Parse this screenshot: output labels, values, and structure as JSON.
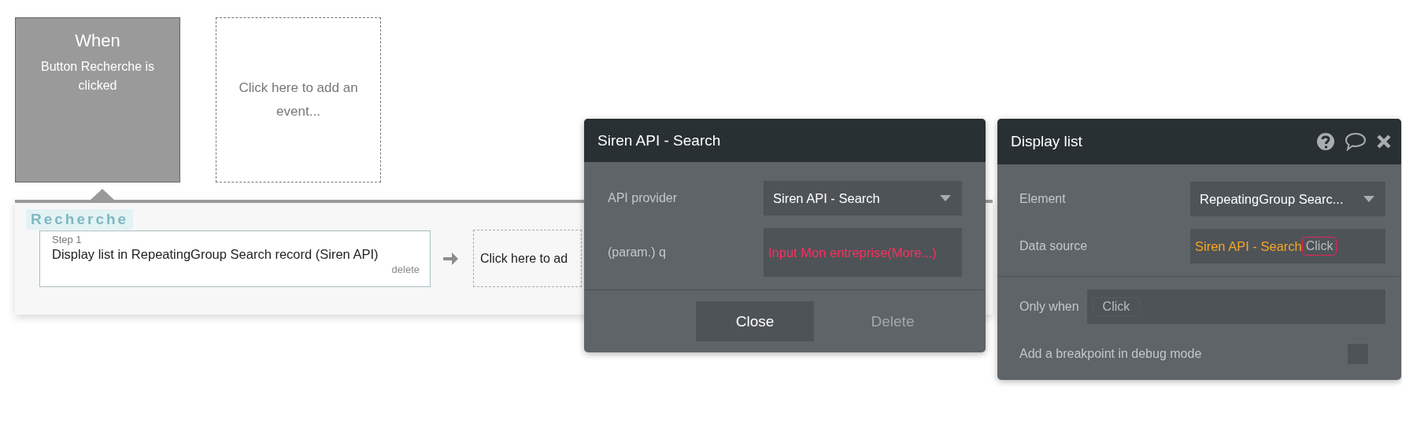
{
  "event_card": {
    "title": "When",
    "description": "Button Recherche is clicked",
    "selected": true
  },
  "add_event": {
    "label": "Click here to add an event..."
  },
  "workflow": {
    "ghost_tag": "Recherche",
    "steps": [
      {
        "label": "Step 1",
        "action": "Display list in RepeatingGroup Search record (Siren API)",
        "delete": "delete"
      }
    ],
    "add_action": "Click here to ad"
  },
  "api_panel": {
    "title": "Siren API - Search",
    "fields": [
      {
        "label": "API provider",
        "kind": "dropdown",
        "value": "Siren API - Search"
      },
      {
        "label": "(param.) q",
        "kind": "expression",
        "value": "Input Mon entreprise(More...)",
        "valid": false
      }
    ],
    "buttons": [
      {
        "label": "Close",
        "disabled": false
      },
      {
        "label": "Delete",
        "disabled": true
      }
    ]
  },
  "action_panel": {
    "title": "Display list",
    "fields": [
      {
        "label": "Element",
        "kind": "dropdown",
        "value": "RepeatingGroup Searc..."
      },
      {
        "label": "Data source",
        "kind": "expression",
        "value": "Siren API - Search",
        "valid": true,
        "chip": "Click"
      }
    ],
    "only_when": {
      "label": "Only when",
      "placeholder": "Click"
    },
    "breakpoint": {
      "label": "Add a breakpoint in debug mode",
      "checked": false
    }
  }
}
